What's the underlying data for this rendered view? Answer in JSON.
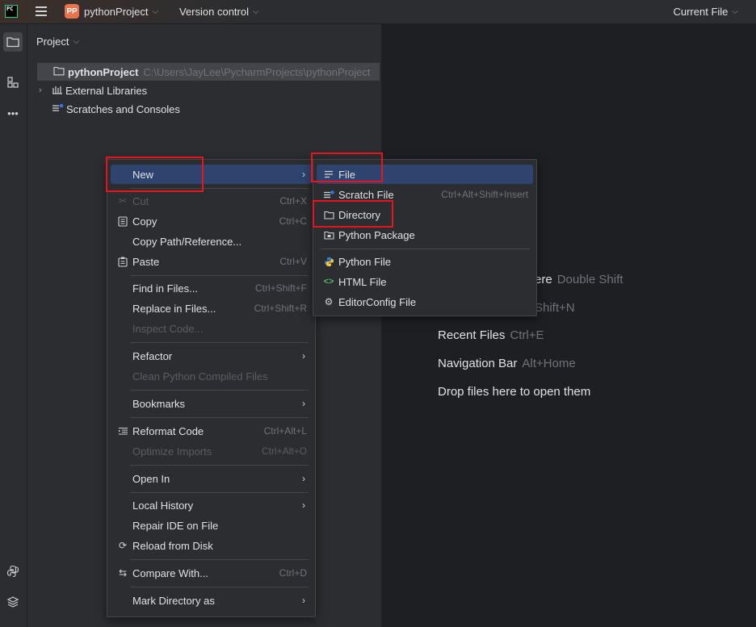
{
  "titlebar": {
    "project_badge": "PP",
    "project_name": "pythonProject",
    "vcs": "Version control",
    "run_config": "Current File"
  },
  "panel": {
    "title": "Project"
  },
  "tree": {
    "root_name": "pythonProject",
    "root_path": "C:\\Users\\JayLee\\PycharmProjects\\pythonProject",
    "external_libraries": "External Libraries",
    "scratches": "Scratches and Consoles"
  },
  "editor_hints": {
    "search_everywhere_tail": "ere",
    "search_everywhere_key": "Double Shift",
    "goto_file_key_tail": "Shift+N",
    "recent_files": "Recent Files",
    "recent_files_key": "Ctrl+E",
    "navigation_bar": "Navigation Bar",
    "navigation_bar_key": "Alt+Home",
    "drop_files": "Drop files here to open them"
  },
  "context_menu": {
    "new": "New",
    "cut": "Cut",
    "cut_key": "Ctrl+X",
    "copy": "Copy",
    "copy_key": "Ctrl+C",
    "copy_path": "Copy Path/Reference...",
    "paste": "Paste",
    "paste_key": "Ctrl+V",
    "find_in_files": "Find in Files...",
    "find_in_files_key": "Ctrl+Shift+F",
    "replace_in_files": "Replace in Files...",
    "replace_in_files_key": "Ctrl+Shift+R",
    "inspect_code": "Inspect Code...",
    "refactor": "Refactor",
    "clean_compiled": "Clean Python Compiled Files",
    "bookmarks": "Bookmarks",
    "reformat_code": "Reformat Code",
    "reformat_code_key": "Ctrl+Alt+L",
    "optimize_imports": "Optimize Imports",
    "optimize_imports_key": "Ctrl+Alt+O",
    "open_in": "Open In",
    "local_history": "Local History",
    "repair_ide": "Repair IDE on File",
    "reload_from_disk": "Reload from Disk",
    "compare_with": "Compare With...",
    "compare_with_key": "Ctrl+D",
    "mark_directory_as": "Mark Directory as"
  },
  "new_submenu": {
    "file": "File",
    "scratch_file": "Scratch File",
    "scratch_file_key": "Ctrl+Alt+Shift+Insert",
    "directory": "Directory",
    "python_package": "Python Package",
    "python_file": "Python File",
    "html_file": "HTML File",
    "editorconfig_file": "EditorConfig File"
  },
  "colors": {
    "background": "#1e1f22",
    "panel": "#2b2d30",
    "highlight": "#2e436e",
    "annotation_red": "#e8141b",
    "badge_orange": "#e8734a"
  }
}
